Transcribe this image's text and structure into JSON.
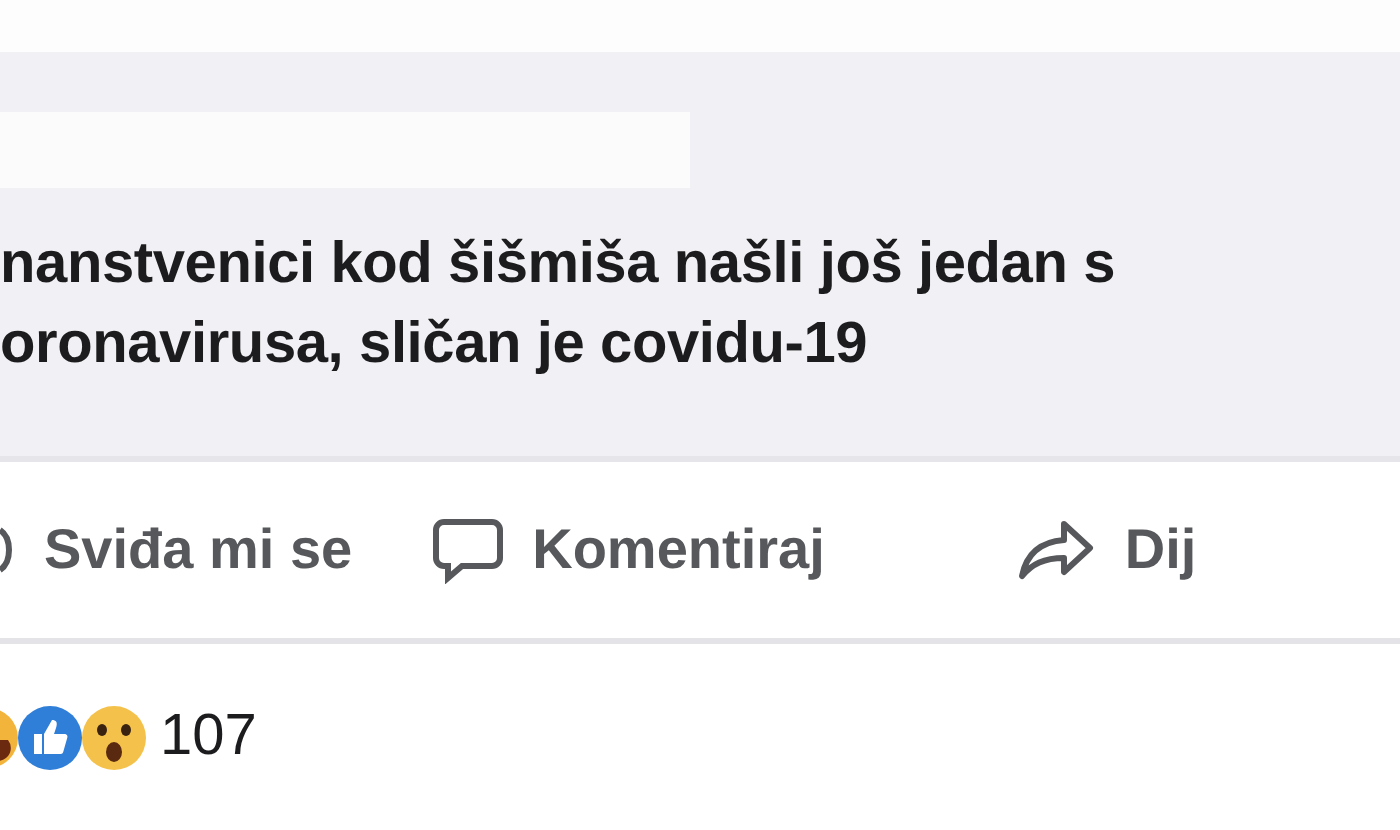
{
  "link_preview": {
    "title_lines": [
      "nanstvenici kod šišmiša našli još jedan s",
      "oronavirusa, sličan je covidu-19"
    ]
  },
  "actions": [
    {
      "kind": "like",
      "label": "Sviđa mi se"
    },
    {
      "kind": "comment",
      "label": "Komentiraj"
    },
    {
      "kind": "share",
      "label": "Dij"
    }
  ],
  "reactions": {
    "icons": [
      {
        "kind": "haha"
      },
      {
        "kind": "like"
      },
      {
        "kind": "wow"
      }
    ],
    "count": "107"
  }
}
